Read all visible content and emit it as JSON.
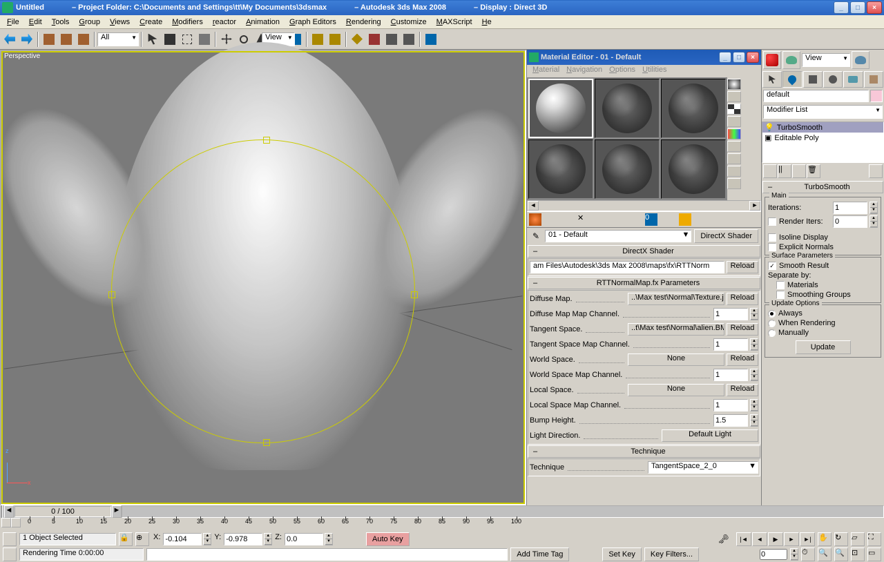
{
  "title": {
    "doc": "Untitled",
    "folder": "– Project Folder: C:\\Documents and Settings\\tt\\My Documents\\3dsmax",
    "app": "– Autodesk 3ds Max 2008",
    "display": "– Display : Direct 3D"
  },
  "menu": [
    "File",
    "Edit",
    "Tools",
    "Group",
    "Views",
    "Create",
    "Modifiers",
    "reactor",
    "Animation",
    "Graph Editors",
    "Rendering",
    "Customize",
    "MAXScript",
    "He"
  ],
  "toolbar": {
    "selset": "All",
    "vpshade": "View"
  },
  "viewport": {
    "label": "Perspective"
  },
  "mateditor": {
    "title": "Material Editor - 01 - Default",
    "menu": [
      "Material",
      "Navigation",
      "Options",
      "Utilities"
    ],
    "currentMat": "01 - Default",
    "shaderBtn": "DirectX Shader",
    "rollout1": {
      "title": "DirectX Shader",
      "path": "am Files\\Autodesk\\3ds Max 2008\\maps\\fx\\RTTNorm",
      "reload": "Reload"
    },
    "rollout2": {
      "title": "RTTNormalMap.fx Parameters",
      "rows": [
        {
          "label": "Diffuse Map.",
          "btn": "..\\Max test\\Normal\\Texture.jpg",
          "act": "Reload"
        },
        {
          "label": "Diffuse Map Map Channel.",
          "spin": "1"
        },
        {
          "label": "Tangent Space.",
          "btn": "..t\\Max test\\Normal\\alien.BMP",
          "act": "Reload"
        },
        {
          "label": "Tangent Space Map Channel.",
          "spin": "1"
        },
        {
          "label": "World Space.",
          "btn": "None",
          "act": "Reload"
        },
        {
          "label": "World Space Map Channel.",
          "spin": "1"
        },
        {
          "label": "Local Space.",
          "btn": "None",
          "act": "Reload"
        },
        {
          "label": "Local Space Map Channel.",
          "spin": "1"
        },
        {
          "label": "Bump Height.",
          "spin": "1.5"
        },
        {
          "label": "Light Direction.",
          "btn": "Default Light"
        }
      ]
    },
    "rollout3": {
      "title": "Technique",
      "label": "Technique",
      "value": "TangentSpace_2_0"
    }
  },
  "cmd": {
    "viewdd": "View",
    "name": "default",
    "modlist_label": "Modifier List",
    "stack": [
      "TurboSmooth",
      "Editable Poly"
    ],
    "turbo": {
      "title": "TurboSmooth",
      "main_label": "Main",
      "iterations_label": "Iterations:",
      "iterations": "1",
      "renderiters_label": "Render Iters:",
      "renderiters": "0",
      "isoline": "Isoline Display",
      "explicit": "Explicit Normals",
      "surface_label": "Surface Parameters",
      "smoothresult": "Smooth Result",
      "separate": "Separate by:",
      "materials": "Materials",
      "smoothgroups": "Smoothing Groups",
      "update_label": "Update Options",
      "always": "Always",
      "whenrender": "When Rendering",
      "manually": "Manually",
      "update_btn": "Update"
    }
  },
  "timeline": {
    "counter": "0 / 100",
    "ticks": [
      0,
      5,
      10,
      15,
      20,
      25,
      30,
      35,
      40,
      45,
      50,
      55,
      60,
      65,
      70,
      75,
      80,
      85,
      90,
      95,
      100
    ]
  },
  "status": {
    "sel": "1 Object Selected",
    "x": "-0.104",
    "y": "-0.978",
    "z": "0.0",
    "render": "Rendering Time  0:00:00",
    "addtag": "Add Time Tag",
    "autokey": "Auto Key",
    "setkey": "Set Key",
    "keyfilters": "Key Filters..."
  }
}
